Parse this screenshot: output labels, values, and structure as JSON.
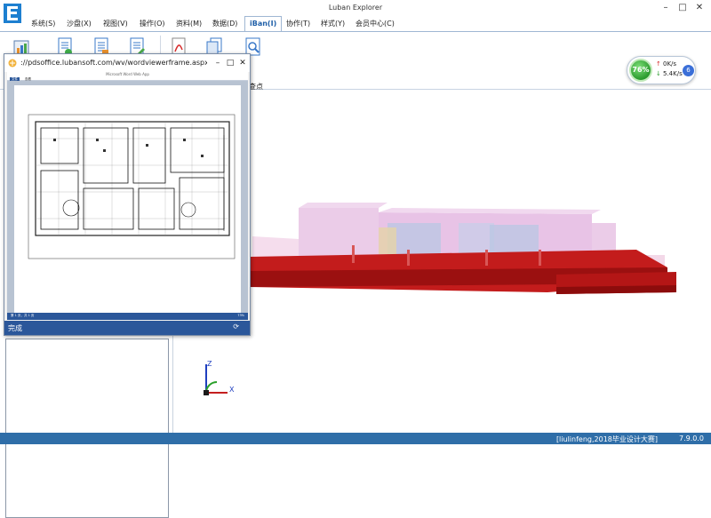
{
  "window": {
    "title": "Luban Explorer",
    "controls": {
      "minimize": "–",
      "maximize": "□",
      "close": "✕"
    }
  },
  "menu": {
    "items": [
      {
        "label": "系统(S)"
      },
      {
        "label": "沙盘(X)"
      },
      {
        "label": "视图(V)"
      },
      {
        "label": "操作(O)"
      },
      {
        "label": "资料(M)"
      },
      {
        "label": "数据(D)"
      },
      {
        "label": "iBan(I)",
        "active": true
      },
      {
        "label": "协作(T)"
      },
      {
        "label": "样式(Y)"
      },
      {
        "label": "会员中心(C)"
      }
    ]
  },
  "ribbon": {
    "tool_label": "查点"
  },
  "network": {
    "percent": "76%",
    "upload": "0K/s",
    "download": "5.4K/s",
    "badge": "6"
  },
  "popup": {
    "url": "://pdsoffice.lubansoft.com/wv/wordviewerframe.aspx?PdfMode=...",
    "doc_title": "Microsoft Word Web App",
    "doc_tabs": [
      "文件",
      "查看"
    ],
    "doc_status_left": "第 1 页，共 1 页",
    "doc_status_right": "73%",
    "footer": "完成",
    "controls": {
      "minimize": "–",
      "maximize": "□",
      "close": "✕"
    }
  },
  "viewport": {
    "axis_z": "Z",
    "axis_x": "X"
  },
  "status": {
    "user": "[liulinfeng,2018毕业设计大赛]",
    "version": "7.9.0.0"
  },
  "colors": {
    "accent": "#2f6ea8",
    "popup_accent": "#2b579a",
    "model_base": "#b31515",
    "model_upper": "#e7c3e3"
  }
}
